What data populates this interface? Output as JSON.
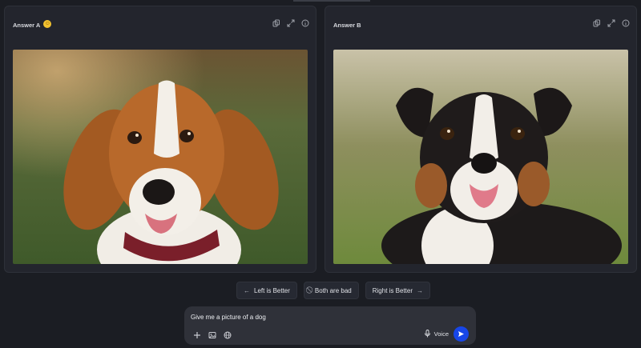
{
  "panels": [
    {
      "title": "Answer A",
      "badge_icon": "smiley-face-icon",
      "icons": [
        "copy-icon",
        "expand-icon",
        "info-icon"
      ]
    },
    {
      "title": "Answer B",
      "icons": [
        "copy-icon",
        "expand-icon",
        "info-icon"
      ]
    }
  ],
  "votes": {
    "left_label": "Left is Better",
    "left_icon": "arrow-left-icon",
    "both_bad_label": "Both are bad",
    "both_bad_icon": "ban-icon",
    "right_label": "Right is Better",
    "right_icon": "arrow-right-icon"
  },
  "composer": {
    "prompt_text": "Give me a picture of a dog",
    "tools": [
      "plus-icon",
      "image-icon",
      "globe-icon"
    ],
    "voice_label": "Voice",
    "send_icon": "send-icon",
    "send_color": "#1746e8"
  },
  "colors": {
    "background": "#1b1d23",
    "panel": "#23252d",
    "accent": "#1746e8"
  }
}
